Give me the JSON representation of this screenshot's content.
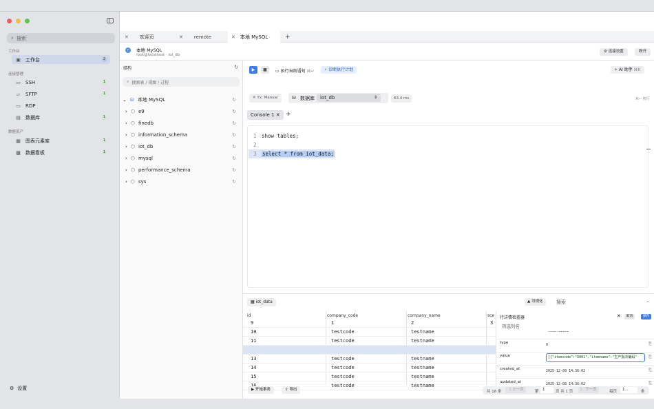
{
  "sidebar": {
    "search_placeholder": "搜索",
    "sections": {
      "workbench": "工作台",
      "connections": "连接管理",
      "assets": "数据资产"
    },
    "items": [
      {
        "label": "工作台",
        "badge": "2"
      },
      {
        "label": "SSH",
        "badge": "1"
      },
      {
        "label": "SFTP",
        "badge": "1"
      },
      {
        "label": "RDP",
        "badge": ""
      },
      {
        "label": "数据库",
        "badge": "1"
      },
      {
        "label": "图表元素库",
        "badge": "1"
      },
      {
        "label": "数据看板",
        "badge": "1"
      }
    ],
    "settings": "设置"
  },
  "tabs": [
    {
      "label": "欢迎页"
    },
    {
      "label": "remote"
    },
    {
      "label": "本地 MySQL"
    }
  ],
  "connection": {
    "name": "本地 MySQL",
    "sub": "root@localhost · iot_db",
    "settings_btn": "连接设置",
    "disconnect_btn": "断开"
  },
  "structure": {
    "title": "结构",
    "search_placeholder": "搜索表 / 视图 / 过程",
    "root": "本地 MySQL",
    "dbs": [
      "e9",
      "finedb",
      "information_schema",
      "iot_db",
      "mysql",
      "performance_schema",
      "sys"
    ]
  },
  "toolbar": {
    "run_current": "执行当前语句",
    "run_hint": "⌘↵",
    "plan": "诊断执行计划",
    "ai": "AI 助手",
    "ai_hint": "⌘K",
    "tx": "Tx: Manual",
    "db_label": "数据库",
    "db_value": "iot_db",
    "time": "63.4 ms",
    "exec_hint": "⌘↵ 执行"
  },
  "console": {
    "tab": "Console 1"
  },
  "code": [
    "show tables;",
    "",
    "select * from iot_data;"
  ],
  "results": {
    "table_name": "iot_data",
    "visualize": "可视化",
    "search_placeholder": "搜索",
    "columns": [
      "id",
      "company_code",
      "company_name",
      "sce"
    ],
    "rows": [
      [
        "9",
        "1",
        "2",
        "3"
      ],
      [
        "10",
        "testcode",
        "testname",
        ""
      ],
      [
        "11",
        "testcode",
        "testname",
        ""
      ],
      [
        "",
        "",
        "",
        ""
      ],
      [
        "13",
        "testcode",
        "testname",
        ""
      ],
      [
        "14",
        "testcode",
        "testname",
        ""
      ],
      [
        "15",
        "testcode",
        "testname",
        ""
      ],
      [
        "16",
        "testcode",
        "testname",
        ""
      ]
    ]
  },
  "detail": {
    "title": "行详情检查器",
    "cancel": "取消",
    "save": "保存",
    "filter_placeholder": "筛选列名",
    "top_value": "0002431102",
    "fields": [
      {
        "name": "type",
        "value": "0"
      },
      {
        "name": "value",
        "value": "[{\"itemcode\":\"X001\",\"itemname\":\"生产批次编码\""
      },
      {
        "name": "created_at",
        "value": "2025-12-08 14:36:02"
      },
      {
        "name": "updated_at",
        "value": "2025-12-08 14:36:02"
      }
    ],
    "dash": "-"
  },
  "footer": {
    "begin_tx": "开始事务",
    "export": "导出",
    "total": "共 16 条",
    "prev": "〈 上一页",
    "page_label": "第",
    "page": "1",
    "page_of": "页 共 1 页",
    "next": "〉 下一页",
    "per_page": "每页",
    "per_value": "1...",
    "unit": "条"
  }
}
